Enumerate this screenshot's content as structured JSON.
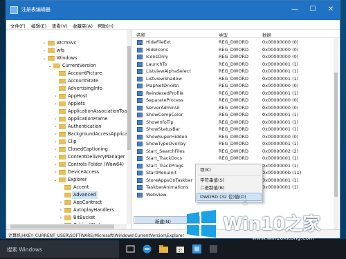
{
  "window": {
    "title": "注册表编辑器",
    "minimize": "—",
    "maximize": "☐",
    "close": "✕"
  },
  "menu": {
    "file": "文件(F)",
    "edit": "编辑(E)",
    "view": "查看(V)",
    "favorites": "收藏夹(A)",
    "help": "帮助(H)"
  },
  "tree": {
    "items": [
      {
        "label": "WcmSvc"
      },
      {
        "label": "wfs"
      },
      {
        "label": "Windows"
      },
      {
        "label": "CurrentVersion"
      },
      {
        "label": "AccountPicture"
      },
      {
        "label": "AccountState"
      },
      {
        "label": "AdvertisingInfo"
      },
      {
        "label": "AppHost"
      },
      {
        "label": "Applets"
      },
      {
        "label": "ApplicationAssociationToas"
      },
      {
        "label": "ApplicationFrame"
      },
      {
        "label": "Authentication"
      },
      {
        "label": "BackgroundAccessApplicat"
      },
      {
        "label": "Clip"
      },
      {
        "label": "ClosedCaptioning"
      },
      {
        "label": "ContentDeliveryManager"
      },
      {
        "label": "Controls Folder (Wow64)"
      },
      {
        "label": "DeviceAccess"
      },
      {
        "label": "Explorer"
      },
      {
        "label": "Accent"
      },
      {
        "label": "Advanced"
      },
      {
        "label": "AppContract"
      },
      {
        "label": "AutoplayHandlers"
      },
      {
        "label": "BitBucket"
      },
      {
        "label": "CabinetState"
      }
    ]
  },
  "list": {
    "columns": {
      "name": "名称",
      "type": "类型",
      "data": "数据"
    },
    "rows": [
      {
        "name": "HideFileExt",
        "type": "REG_DWORD",
        "data": "0x00000000 (0)"
      },
      {
        "name": "HideIcons",
        "type": "REG_DWORD",
        "data": "0x00000000 (0)"
      },
      {
        "name": "IconsOnly",
        "type": "REG_DWORD",
        "data": "0x00000000 (0)"
      },
      {
        "name": "LaunchTo",
        "type": "REG_DWORD",
        "data": "0x00000001 (1)"
      },
      {
        "name": "ListviewAlphaSelect",
        "type": "REG_DWORD",
        "data": "0x00000001 (1)"
      },
      {
        "name": "ListviewShadow",
        "type": "REG_DWORD",
        "data": "0x00000001 (1)"
      },
      {
        "name": "MapNetDrvBtn",
        "type": "REG_DWORD",
        "data": "0x00000000 (0)"
      },
      {
        "name": "ReindexedProfile",
        "type": "REG_DWORD",
        "data": "0x00000001 (1)"
      },
      {
        "name": "SeparateProcess",
        "type": "REG_DWORD",
        "data": "0x00000000 (0)"
      },
      {
        "name": "ServerAdminUI",
        "type": "REG_DWORD",
        "data": "0x00000000 (0)"
      },
      {
        "name": "ShowCompColor",
        "type": "REG_DWORD",
        "data": "0x00000001 (1)"
      },
      {
        "name": "ShowInfoTip",
        "type": "REG_DWORD",
        "data": "0x00000001 (1)"
      },
      {
        "name": "ShowStatusBar",
        "type": "REG_DWORD",
        "data": "0x00000001 (1)"
      },
      {
        "name": "ShowSuperHidden",
        "type": "REG_DWORD",
        "data": "0x00000000 (0)"
      },
      {
        "name": "ShowTypeOverlay",
        "type": "REG_DWORD",
        "data": "0x00000001 (1)"
      },
      {
        "name": "Start_SearchFiles",
        "type": "REG_DWORD",
        "data": "0x00000002 (2)"
      },
      {
        "name": "Start_TrackDocs",
        "type": "REG_DWORD",
        "data": "0x00000001 (1)"
      },
      {
        "name": "Start_TrackProgs",
        "type": "REG_DWORD",
        "data": "0x00000001 (1)"
      },
      {
        "name": "StartMenuInit",
        "type": "REG_DWORD",
        "data": "0x0000000b (11)"
      },
      {
        "name": "StoreAppsOnTaskbar",
        "type": "REG_DWORD",
        "data": "0x00000001 (1)"
      },
      {
        "name": "TaskbarAnimations",
        "type": "REG_DWORD",
        "data": "0x00000001 (1)"
      },
      {
        "name": "WebView",
        "type": "",
        "data": ""
      }
    ]
  },
  "new_menu": {
    "label": "新建(N)",
    "chevron": "›"
  },
  "submenu": {
    "key": "项(K)",
    "string": "字符串值(S)",
    "binary": "二进制值(B)",
    "dword": "DWORD (32 位)值(D)"
  },
  "status": {
    "path": "计算机\\HKEY_CURRENT_USER\\SOFTWARE\\Microsoft\\Windows\\CurrentVersion\\Explorer"
  },
  "taskbar": {
    "search_placeholder": "搜索 Windows"
  },
  "watermark": {
    "brand": "Win10",
    "brand_suffix": "之家",
    "url": "www.win10xitong.com"
  },
  "colors": {
    "titlebar": "#1f72c4",
    "selection": "#cce4f7",
    "menu_highlight": "#cfe2f6",
    "taskbar": "#151a20"
  }
}
